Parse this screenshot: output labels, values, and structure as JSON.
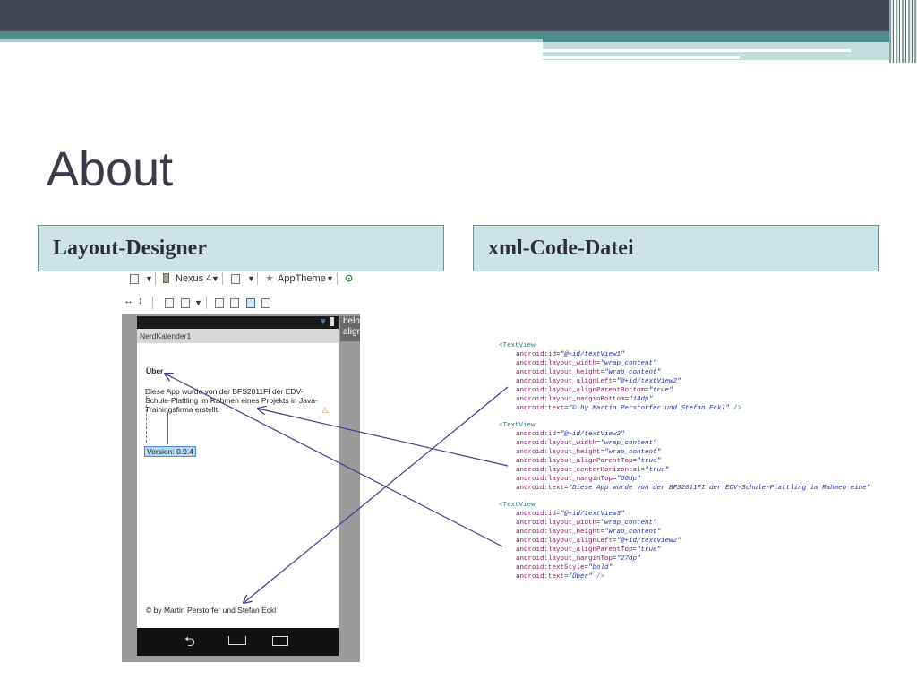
{
  "slide": {
    "title": "About",
    "left_header": "Layout-Designer",
    "right_header": "xml-Code-Datei"
  },
  "designer": {
    "toolbar": {
      "device": "Nexus 4",
      "theme": "AppTheme"
    },
    "app_title": "NerdKalender1",
    "side_text": "below\nalign",
    "screen": {
      "uber_label": "Über",
      "description": "Diese App wurde von der BFS2011FI der EDV-Schule-Plattling im Rahmen eines Projekts in Java-Trainingsfirma erstellt.",
      "version_label": "Version: 0.9.4",
      "copyright": "© by Martin Perstorfer und Stefan Eckl"
    }
  },
  "code": {
    "blocks": [
      {
        "tag": "<TextView",
        "attrs": [
          [
            "android:id",
            "@+id/textView1"
          ],
          [
            "android:layout_width",
            "wrap_content"
          ],
          [
            "android:layout_height",
            "wrap_content"
          ],
          [
            "android:layout_alignLeft",
            "@+id/textView2"
          ],
          [
            "android:layout_alignParentBottom",
            "true"
          ],
          [
            "android:layout_marginBottom",
            "14dp"
          ],
          [
            "android:text",
            "© by Martin Perstorfer und Stefan Eckl"
          ]
        ]
      },
      {
        "tag": "<TextView",
        "attrs": [
          [
            "android:id",
            "@+id/textView2"
          ],
          [
            "android:layout_width",
            "wrap_content"
          ],
          [
            "android:layout_height",
            "wrap_content"
          ],
          [
            "android:layout_alignParentTop",
            "true"
          ],
          [
            "android:layout_centerHorizontal",
            "true"
          ],
          [
            "android:layout_marginTop",
            "66dp"
          ],
          [
            "android:text",
            "Diese App wurde von der BFS2011FI der EDV-Schule-Plattling im Rahmen eine"
          ]
        ]
      },
      {
        "tag": "<TextView",
        "attrs": [
          [
            "android:id",
            "@+id/textView3"
          ],
          [
            "android:layout_width",
            "wrap_content"
          ],
          [
            "android:layout_height",
            "wrap_content"
          ],
          [
            "android:layout_alignLeft",
            "@+id/textView2"
          ],
          [
            "android:layout_alignParentTop",
            "true"
          ],
          [
            "android:layout_marginTop",
            "27dp"
          ],
          [
            "android:textStyle",
            "bold"
          ],
          [
            "android:text",
            "Über"
          ]
        ]
      }
    ],
    "close": " />"
  },
  "colors": {
    "header_bg": "#cde4e5",
    "top_bar": "#444657",
    "teal": "#4d8d8c",
    "arrow": "#3d3f8a"
  }
}
